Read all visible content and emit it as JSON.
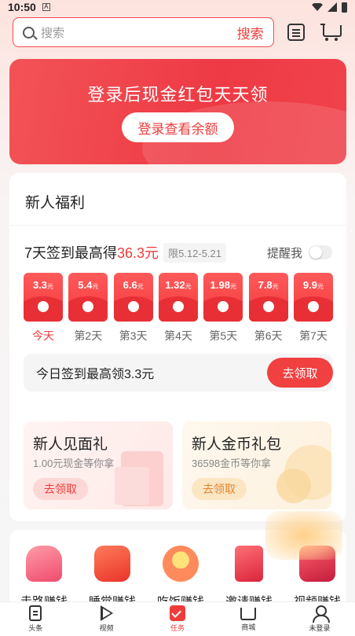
{
  "status_bar": {
    "time": "10:50",
    "notif_glyph": "A"
  },
  "search": {
    "placeholder": "搜索",
    "button_label": "搜索"
  },
  "banner": {
    "title": "登录后现金红包天天领",
    "button_label": "登录查看余额"
  },
  "welfare": {
    "heading": "新人福利",
    "signin_prefix": "7天签到最高得",
    "signin_amount": "36.3元",
    "date_limit": "限5.12-5.21",
    "remind_label": "提醒我",
    "remind_on": false,
    "days": [
      {
        "amount": "3.3",
        "unit": "元",
        "label": "今天",
        "today": true
      },
      {
        "amount": "5.4",
        "unit": "元",
        "label": "第2天"
      },
      {
        "amount": "6.6",
        "unit": "元",
        "label": "第3天"
      },
      {
        "amount": "1.32",
        "unit": "元",
        "label": "第4天"
      },
      {
        "amount": "1.98",
        "unit": "元",
        "label": "第5天"
      },
      {
        "amount": "7.8",
        "unit": "元",
        "label": "第6天"
      },
      {
        "amount": "9.9",
        "unit": "元",
        "label": "第7天"
      }
    ],
    "today_text": "今日签到最高领3.3元",
    "today_button": "去领取",
    "gifts": [
      {
        "title": "新人见面礼",
        "subtitle": "1.00元现金等你拿",
        "button": "去领取"
      },
      {
        "title": "新人金币礼包",
        "subtitle": "36598金币等你拿",
        "button": "去领取"
      }
    ]
  },
  "earn": {
    "items": [
      {
        "label": "走路赚钱",
        "icon": "shoe-icon"
      },
      {
        "label": "睡觉赚钱",
        "icon": "bed-icon"
      },
      {
        "label": "吃饭赚钱",
        "icon": "bowl-icon"
      },
      {
        "label": "邀请赚钱",
        "icon": "invite-icon"
      },
      {
        "label": "视频赚钱",
        "icon": "video-icon"
      }
    ]
  },
  "tabbar": {
    "items": [
      {
        "label": "头条",
        "icon": "doc-icon"
      },
      {
        "label": "视频",
        "icon": "play-icon"
      },
      {
        "label": "任务",
        "icon": "task-icon",
        "active": true
      },
      {
        "label": "商城",
        "icon": "cart-icon"
      },
      {
        "label": "未登录",
        "icon": "user-icon"
      }
    ]
  },
  "colors": {
    "accent": "#ef3b3b",
    "banner": "#f04048",
    "coin": "#e0842c"
  }
}
